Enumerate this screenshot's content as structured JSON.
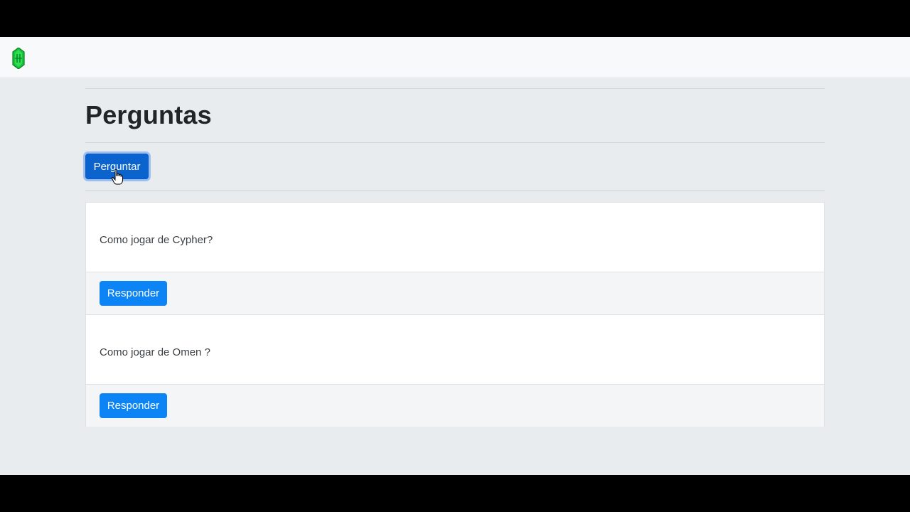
{
  "navbar": {
    "logo_icon": "green-gem-icon"
  },
  "page": {
    "title": "Perguntas",
    "ask_button_label": "Perguntar"
  },
  "questions": [
    {
      "text": "Como jogar de Cypher?",
      "answer_label": "Responder"
    },
    {
      "text": "Como jogar de Omen ?",
      "answer_label": "Responder"
    }
  ],
  "colors": {
    "primary": "#0d84f5",
    "primary_focus": "#0b63ce",
    "background": "#e9ecef",
    "navbar": "#f8f9fa",
    "logo": "#19c43a"
  }
}
